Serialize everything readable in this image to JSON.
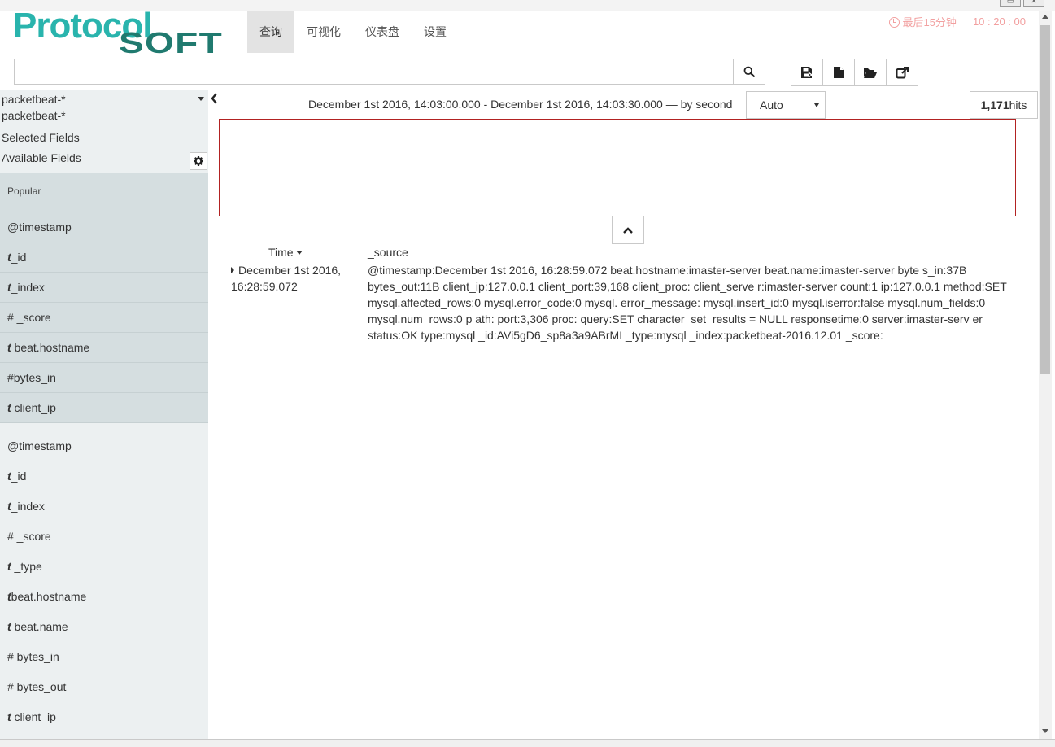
{
  "brand": {
    "logo_line1": "Protocol",
    "logo_line2": "SOFT",
    "logo_color_primary": "#29b4ad",
    "logo_color_secondary": "#207a6f"
  },
  "nav": {
    "tabs": [
      {
        "label": "查询",
        "active": true
      },
      {
        "label": "可视化",
        "active": false
      },
      {
        "label": "仪表盘",
        "active": false
      },
      {
        "label": "设置",
        "active": false
      }
    ]
  },
  "timepicker": {
    "label": "最后15分钟",
    "clock": "10 : 20 : 00",
    "color": "#f2a0a0"
  },
  "search": {
    "value": "",
    "placeholder": "",
    "icon": "search-icon"
  },
  "toolbar": {
    "buttons": [
      {
        "name": "save-search-button",
        "icon": "save-icon"
      },
      {
        "name": "new-search-button",
        "icon": "file-icon"
      },
      {
        "name": "open-search-button",
        "icon": "folder-open-icon"
      },
      {
        "name": "share-search-button",
        "icon": "share-icon"
      }
    ]
  },
  "sidebar": {
    "index_pattern": "packetbeat-*",
    "index_pattern_sub": "packetbeat-*",
    "selected_fields_label": "Selected Fields",
    "available_fields_label": "Available Fields",
    "popular_label": "Popular",
    "popular_fields": [
      {
        "type": "",
        "name": "@timestamp"
      },
      {
        "type": "t",
        "name": "_id"
      },
      {
        "type": "t",
        "name": "_index"
      },
      {
        "type": "#",
        "name": " _score"
      },
      {
        "type": "t",
        "name": " beat.hostname"
      },
      {
        "type": "#",
        "name": "bytes_in"
      },
      {
        "type": "t",
        "name": " client_ip"
      }
    ],
    "all_fields": [
      {
        "type": "",
        "name": "@timestamp"
      },
      {
        "type": "t",
        "name": "_id"
      },
      {
        "type": "t",
        "name": "_index"
      },
      {
        "type": "#",
        "name": " _score"
      },
      {
        "type": "t",
        "name": " _type"
      },
      {
        "type": "t",
        "name": "beat.hostname"
      },
      {
        "type": "t",
        "name": " beat.name"
      },
      {
        "type": "#",
        "name": " bytes_in"
      },
      {
        "type": "#",
        "name": " bytes_out"
      },
      {
        "type": "t",
        "name": " client_ip"
      }
    ]
  },
  "results": {
    "time_range": "December 1st 2016, 14:03:00.000 - December 1st 2016, 14:03:30.000 — by second",
    "interval": "Auto",
    "hits_count": "1,171",
    "hits_label": "hits",
    "col_time": "Time",
    "col_source": "_source",
    "rows": [
      {
        "time": "December 1st 2016, 16:28:59.072",
        "source": "@timestamp:December 1st 2016, 16:28:59.072 beat.hostname:imaster-server beat.name:imaster-server byte s_in:37B bytes_out:11B client_ip:127.0.0.1 client_port:39,168 client_proc: client_serve r:imaster-server count:1 ip:127.0.0.1 method:SET mysql.affected_rows:0 mysql.error_code:0 mysql. error_message: mysql.insert_id:0 mysql.iserror:false mysql.num_fields:0 mysql.num_rows:0 p ath: port:3,306 proc: query:SET character_set_results = NULL responsetime:0 server:imaster-serv er status:OK type:mysql _id:AVi5gD6_sp8a3a9ABrMI _type:mysql _index:packetbeat-2016.12.01 _score:"
      }
    ]
  }
}
